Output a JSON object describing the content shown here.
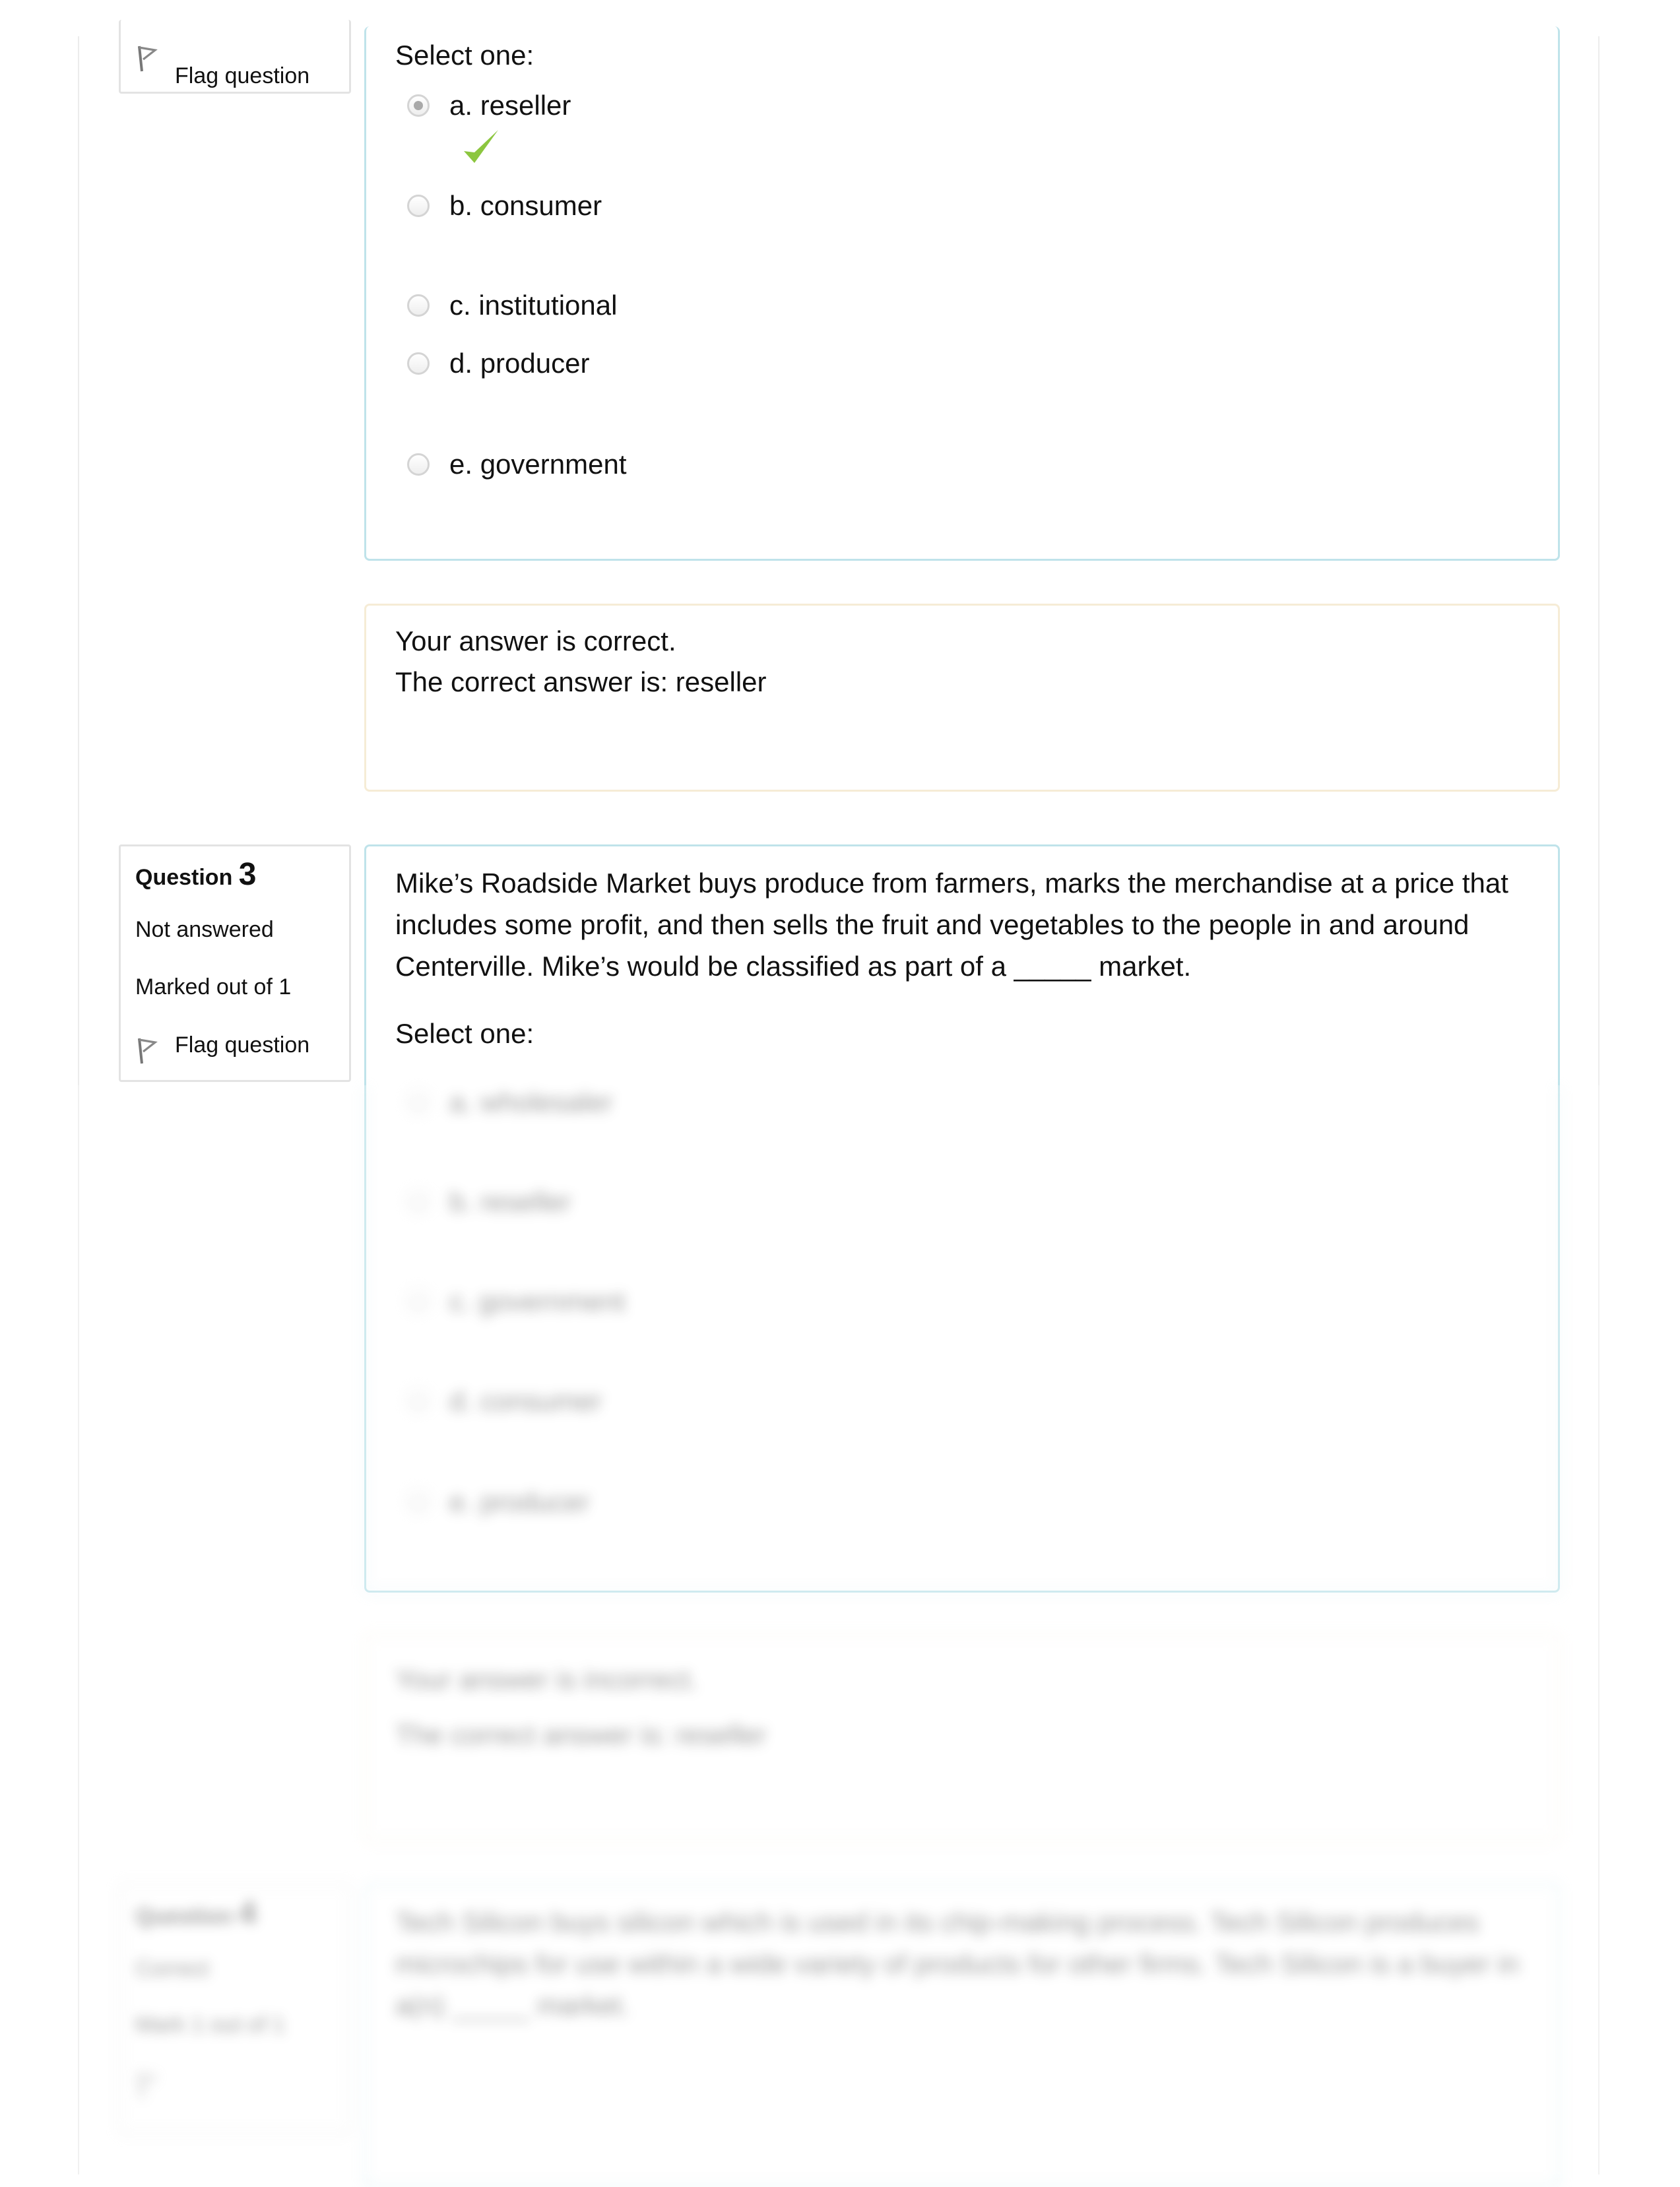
{
  "q2": {
    "flag_label": "Flag question",
    "prompt": "Select one:",
    "options": [
      {
        "label": "a. reseller",
        "selected": true,
        "correct": true
      },
      {
        "label": "b. consumer",
        "selected": false
      },
      {
        "label": "c. institutional",
        "selected": false
      },
      {
        "label": "d. producer",
        "selected": false
      },
      {
        "label": "e. government",
        "selected": false
      }
    ],
    "feedback": {
      "result": "Your answer is correct.",
      "correct_answer": "The correct answer is: reseller"
    }
  },
  "q3": {
    "title_prefix": "Question",
    "number": "3",
    "state": "Not answered",
    "mark": "Marked out of 1",
    "flag_label": "Flag question",
    "text": "Mike’s Roadside Market buys produce from farmers, marks the merchandise at a price that includes some profit, and then sells the fruit and vegetables to the people in and around Centerville. Mike’s would be classified as part of a _____ market.",
    "prompt": "Select one:",
    "options": [
      "a. wholesaler",
      "b. reseller",
      "c. government",
      "d. consumer",
      "e. producer"
    ],
    "feedback": {
      "result": "Your answer is incorrect.",
      "correct_answer": "The correct answer is: reseller"
    }
  },
  "q4": {
    "title_prefix": "Question",
    "number": "4",
    "state": "Correct",
    "mark": "Mark 1 out of 1",
    "text": "Tech Silicon buys silicon which is used in its chip-making process. Tech Silicon produces microchips for use within a wide variety of products for other firms. Tech Silicon is a buyer in a(n) _____ market."
  },
  "colors": {
    "check": "#8cc63f",
    "content_border": "#bfe3ea",
    "feedback_border": "#f6ecd6"
  }
}
